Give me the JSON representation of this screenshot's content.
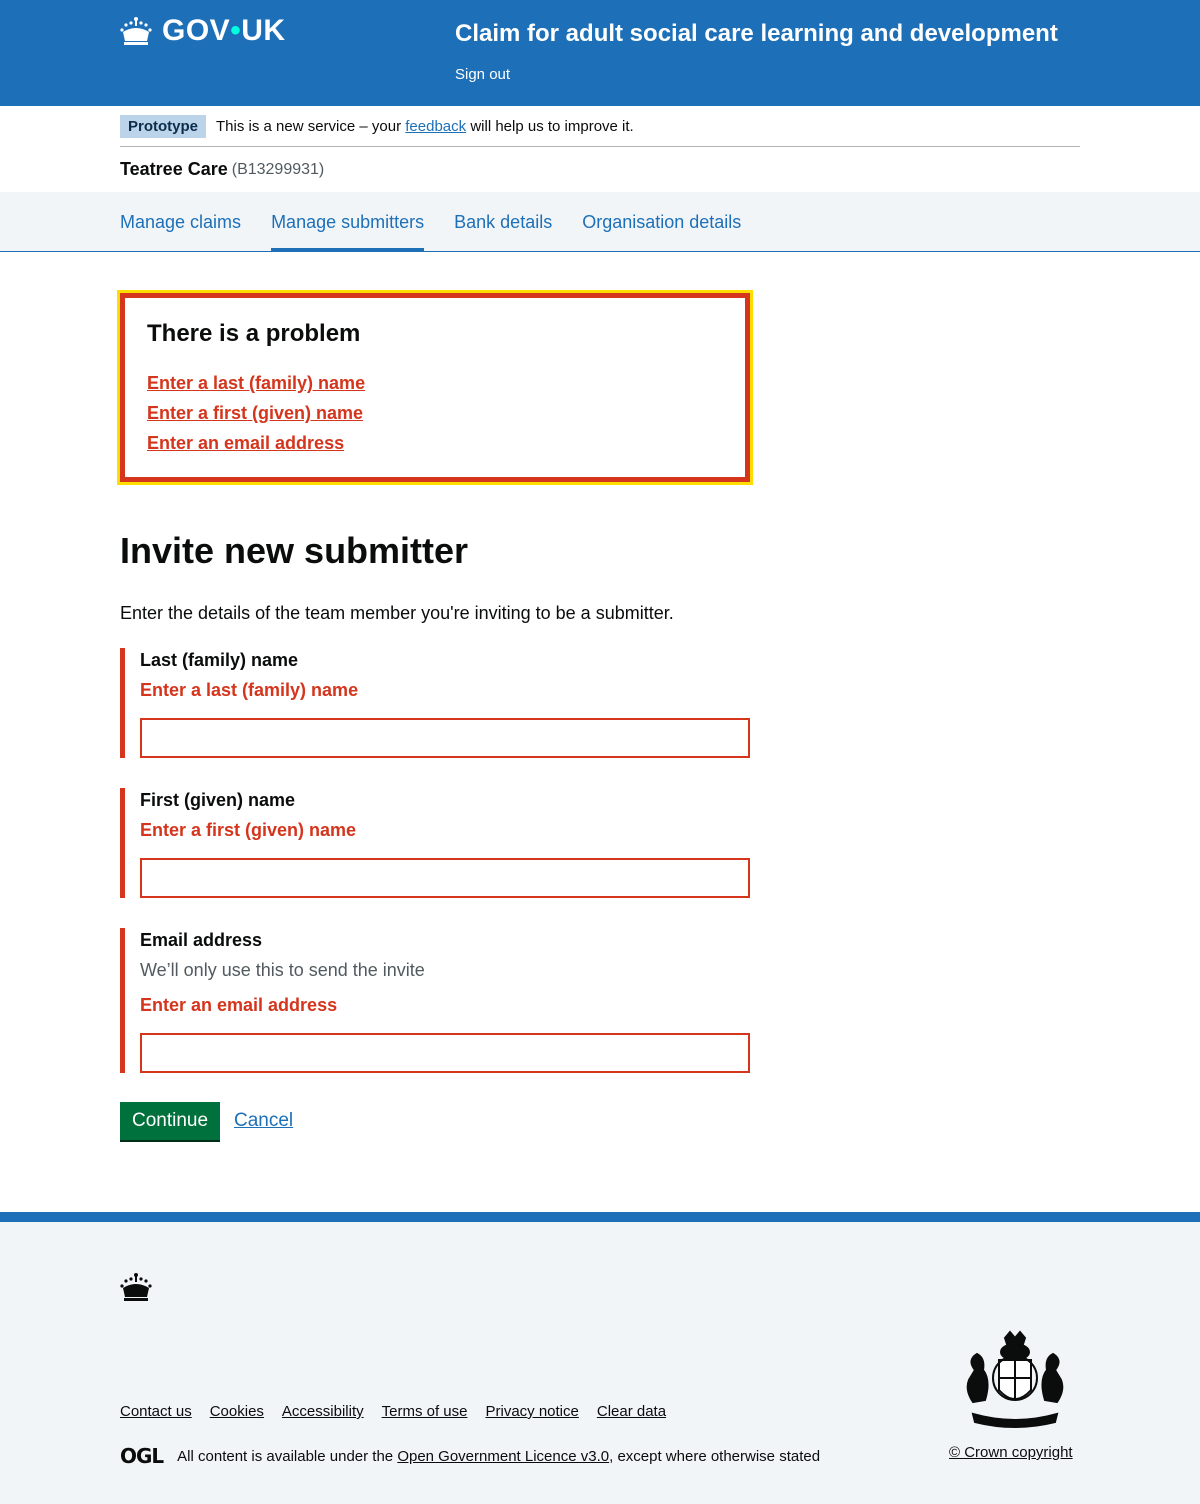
{
  "header": {
    "logo_text": "GOV",
    "logo_text_2": "UK",
    "service_name": "Claim for adult social care learning and development",
    "sign_out": "Sign out"
  },
  "phase": {
    "tag": "Prototype",
    "text_before": "This is a new service – your ",
    "link": "feedback",
    "text_after": " will help us to improve it."
  },
  "org": {
    "name": "Teatree Care",
    "id": "(B13299931)"
  },
  "nav": {
    "items": [
      "Manage claims",
      "Manage submitters",
      "Bank details",
      "Organisation details"
    ],
    "active": "Manage submitters"
  },
  "error_summary": {
    "title": "There is a problem",
    "errors": [
      "Enter a last (family) name",
      "Enter a first (given) name",
      "Enter an email address"
    ]
  },
  "main": {
    "heading": "Invite new submitter",
    "intro": "Enter the details of the team member you're inviting to be a submitter.",
    "fields": [
      {
        "label": "Last (family) name",
        "error": "Enter a last (family) name",
        "value": ""
      },
      {
        "label": "First (given) name",
        "error": "Enter a first (given) name",
        "value": ""
      },
      {
        "label": "Email address",
        "hint": "We’ll only use this to send the invite",
        "error": "Enter an email address",
        "value": ""
      }
    ],
    "continue": "Continue",
    "cancel": "Cancel"
  },
  "footer": {
    "links": [
      "Contact us",
      "Cookies",
      "Accessibility",
      "Terms of use",
      "Privacy notice",
      "Clear data"
    ],
    "ogl_logo": "OGL",
    "licence_before": "All content is available under the ",
    "licence_link": "Open Government Licence v3.0",
    "licence_after": ", except where otherwise stated",
    "copyright": "© Crown copyright"
  },
  "colors": {
    "brand": "#1d70b8",
    "error": "#d4351c",
    "focus": "#ffdd00",
    "button": "#00703c"
  }
}
